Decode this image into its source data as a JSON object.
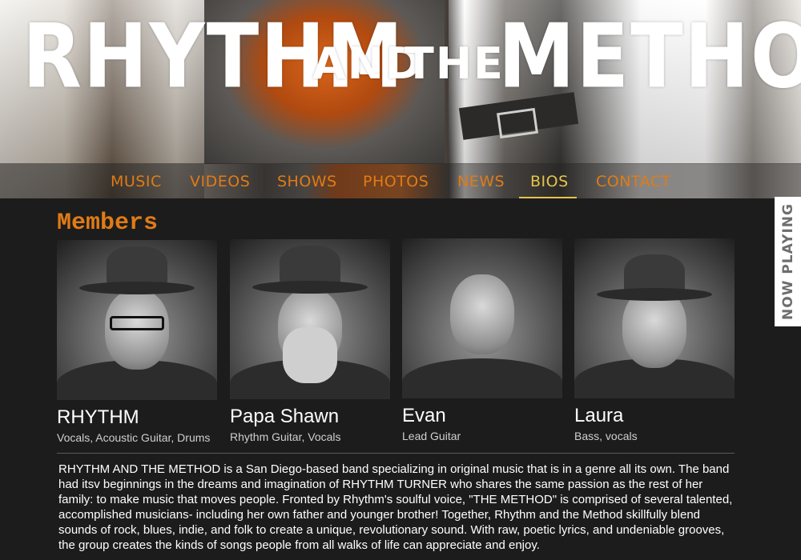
{
  "banner": {
    "title_word_1": "RHYTHM",
    "title_word_2": "AND",
    "title_word_3": "THE",
    "title_word_4": "METHOD"
  },
  "nav": {
    "items": [
      {
        "label": "MUSIC"
      },
      {
        "label": "VIDEOS"
      },
      {
        "label": "SHOWS"
      },
      {
        "label": "PHOTOS"
      },
      {
        "label": "NEWS"
      },
      {
        "label": "BIOS"
      },
      {
        "label": "CONTACT"
      }
    ],
    "active": "BIOS"
  },
  "now_playing": {
    "label": "NOW PLAYING"
  },
  "members": {
    "title": "Members",
    "list": [
      {
        "name": "RHYTHM",
        "role": "Vocals, Acoustic Guitar, Drums"
      },
      {
        "name": "Papa Shawn",
        "role": "Rhythm Guitar, Vocals"
      },
      {
        "name": "Evan",
        "role": "Lead Guitar"
      },
      {
        "name": "Laura",
        "role": "Bass, vocals"
      }
    ]
  },
  "bio": {
    "text": "RHYTHM AND THE METHOD is a San Diego-based band specializing in original music that is in a genre all its own. The band had itsv beginnings in the dreams and imagination of RHYTHM TURNER who shares the same passion as the rest of her family: to make music that moves people. Fronted by Rhythm's soulful voice, \"THE METHOD\" is comprised of several talented, accomplished musicians- including her own father and younger brother! Together, Rhythm and the Method skillfully blend sounds of rock, blues, indie, and folk to create a unique, revolutionary sound. With raw, poetic lyrics, and undeniable grooves, the group creates the kinds of songs people from all walks of life can appreciate and enjoy."
  },
  "colors": {
    "accent": "#e07b16",
    "active_nav": "#e5c34a",
    "background": "#1c1c1c"
  }
}
